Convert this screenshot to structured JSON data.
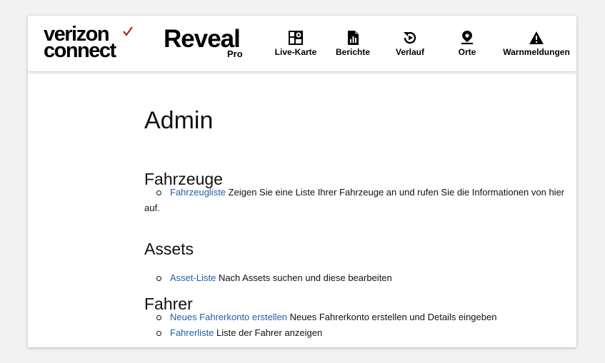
{
  "header": {
    "brand_line1": "verizon",
    "brand_line2": "connect",
    "product_name": "Reveal",
    "product_tier": "Pro",
    "accent_color": "#cd040b",
    "nav": [
      {
        "label": "Live-Karte",
        "icon": "map-icon"
      },
      {
        "label": "Berichte",
        "icon": "report-icon"
      },
      {
        "label": "Verlauf",
        "icon": "history-icon"
      },
      {
        "label": "Orte",
        "icon": "location-pin-icon"
      },
      {
        "label": "Warnmeldungen",
        "icon": "warning-icon"
      }
    ]
  },
  "page": {
    "title": "Admin",
    "sections": [
      {
        "title": "Fahrzeuge",
        "items": [
          {
            "link": "Fahrzeugliste",
            "description": "Zeigen Sie eine Liste Ihrer Fahrzeuge an und rufen Sie die Informationen von hier auf."
          }
        ]
      },
      {
        "title": "Assets",
        "items": [
          {
            "link": "Asset-Liste",
            "description": "Nach Assets suchen und diese bearbeiten"
          }
        ]
      },
      {
        "title": "Fahrer",
        "items": [
          {
            "link": "Neues Fahrerkonto erstellen",
            "description": "Neues Fahrerkonto erstellen und Details eingeben"
          },
          {
            "link": "Fahrerliste",
            "description": "Liste der Fahrer anzeigen"
          }
        ]
      }
    ]
  }
}
